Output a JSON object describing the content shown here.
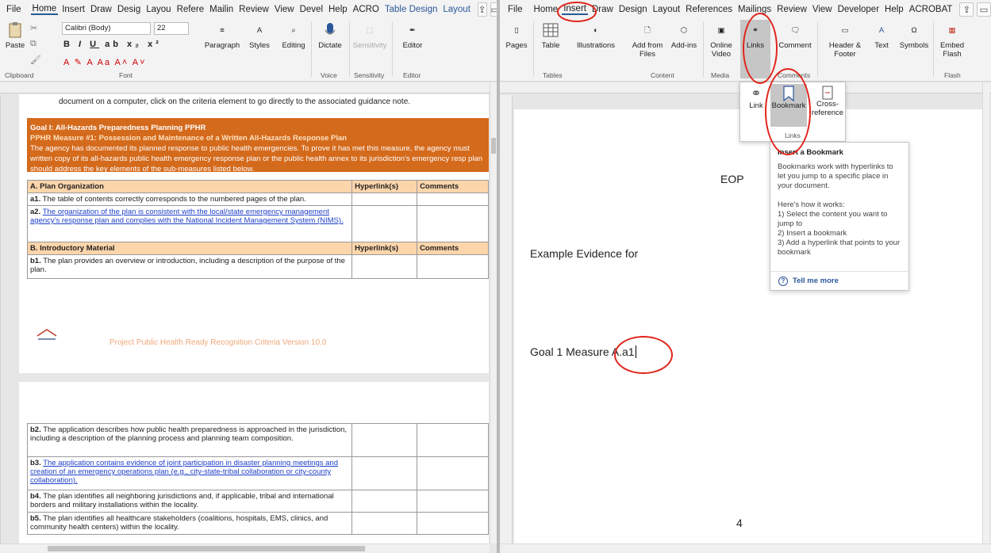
{
  "left": {
    "tabs": [
      "File",
      "Home",
      "Insert",
      "Draw",
      "Desig",
      "Layou",
      "Refere",
      "Mailin",
      "Review",
      "View",
      "Devel",
      "Help",
      "ACRO",
      "Table Design",
      "Layout"
    ],
    "ribbon": {
      "paste": "Paste",
      "font_name": "Calibri (Body)",
      "font_size": "22",
      "paragraph": "Paragraph",
      "styles": "Styles",
      "editing": "Editing",
      "dictate": "Dictate",
      "sensitivity": "Sensitivity",
      "editor": "Editor",
      "groups": {
        "clipboard": "Clipboard",
        "font": "Font",
        "voice": "Voice",
        "sensitivity": "Sensitivity",
        "editor": "Editor"
      }
    },
    "doc": {
      "intro": "document on a computer, click on the criteria element to go directly to the associated guidance note.",
      "goal_title": "Goal I: All-Hazards Preparedness Planning PPHR",
      "goal_measure": "PPHR Measure #1: Possession and Maintenance of a Written All-Hazards Response Plan",
      "goal_body": "The agency has documented its planned response to public health emergencies. To prove it has met this measure, the agency must written copy of its all-hazards public health emergency response plan or the public health annex to its jurisdiction's emergency resp plan should address the key elements of the sub-measures listed below.",
      "col_hyperlinks": "Hyperlink(s)",
      "col_comments": "Comments",
      "section_a": "A.  Plan Organization",
      "a1_id": "a1.",
      "a1": " The table of contents correctly corresponds to the numbered pages of the plan.",
      "a2_id": "a2.",
      "a2": "The organization of the plan is consistent with the local/state emergency management agency's response plan and complies with the National Incident Management System (NIMS).",
      "section_b": "B.  Introductory Material",
      "b1_id": "b1.",
      "b1": " The plan provides an overview or introduction, including a description of the purpose of the plan.",
      "footer": "Project Public Health Ready Recognition Criteria Version 10.0",
      "b2_id": "b2.",
      "b2": " The application describes how public health preparedness is approached in the jurisdiction, including a description of the planning process and planning team composition.",
      "b3_id": "b3.",
      "b3": "The application contains evidence of joint participation in disaster planning meetings and creation of an emergency operations plan (e.g., city-state-tribal collaboration or city-county collaboration).",
      "b4_id": "b4.",
      "b4": " The plan identifies all neighboring jurisdictions and, if applicable, tribal and international borders and military installations within the locality.",
      "b5_id": "b5.",
      "b5": " The plan identifies all healthcare stakeholders (coalitions, hospitals, EMS, clinics, and community health centers) within the locality."
    }
  },
  "right": {
    "tabs": [
      "File",
      "Home",
      "Insert",
      "Draw",
      "Design",
      "Layout",
      "References",
      "Mailings",
      "Review",
      "View",
      "Developer",
      "Help",
      "ACROBAT"
    ],
    "ribbon": {
      "pages": "Pages",
      "table": "Table",
      "illustrations": "Illustrations",
      "add_from_files": "Add from Files",
      "add_ins": "Add-ins",
      "online_video": "Online Video",
      "links": "Links",
      "comment": "Comment",
      "header_footer": "Header & Footer",
      "text": "Text",
      "symbols": "Symbols",
      "embed_flash": "Embed Flash",
      "groups": {
        "tables": "Tables",
        "content": "Content",
        "media": "Media",
        "comments": "Comments",
        "flash": "Flash"
      }
    },
    "dropdown": {
      "link": "Link",
      "bookmark": "Bookmark",
      "cross_reference": "Cross-reference",
      "group": "Links"
    },
    "tooltip": {
      "title": "Insert a Bookmark",
      "body": "Bookmarks work with hyperlinks to let you jump to a specific place in your document.",
      "how": "Here's how it works:",
      "step1": "1) Select the content you want to jump to",
      "step2": "2) Insert a bookmark",
      "step3": "3) Add a hyperlink that points to your bookmark",
      "tell_more": "Tell me more"
    },
    "doc": {
      "eop": "EOP",
      "evidence": "Example Evidence for",
      "goal_measure": "Goal 1 Measure A.a1",
      "page_number": "4"
    }
  },
  "colors": {
    "accent": "#2b579a",
    "goal_orange": "#d46a1c",
    "header_peach": "#fdd5ab",
    "annotation_red": "#e0251b"
  }
}
